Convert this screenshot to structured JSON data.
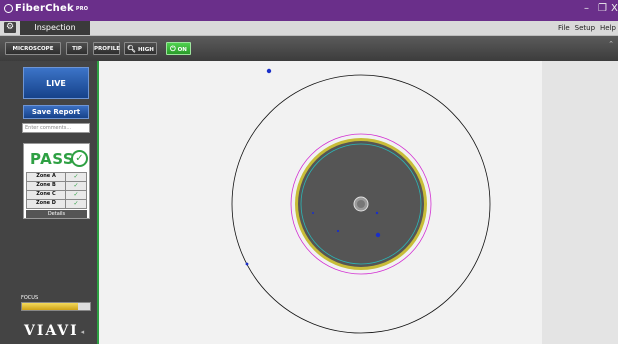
{
  "titlebar": {
    "app_name": "FiberChek",
    "app_suffix": "PRO",
    "minimize": "–",
    "restore": "❐",
    "close": "X"
  },
  "tabs": {
    "gear": "⚙",
    "active_tab": "Inspection",
    "menu_file": "File",
    "menu_setup": "Setup",
    "menu_help": "Help"
  },
  "toolbar": {
    "microscope": "MICROSCOPE",
    "tip": "TIP",
    "profile": "PROFILE",
    "high": "HIGH",
    "on": "ON"
  },
  "sidebar": {
    "live": "LIVE",
    "save_report": "Save Report",
    "comments_placeholder": "Enter comments...",
    "result": "PASS",
    "zones": [
      {
        "name": "Zone A",
        "status": "✓"
      },
      {
        "name": "Zone B",
        "status": "✓"
      },
      {
        "name": "Zone C",
        "status": "✓"
      },
      {
        "name": "Zone D",
        "status": "✓"
      }
    ],
    "details": "Details",
    "focus_label": "FOCUS",
    "focus_level": 0.82,
    "brand": "VIAVI"
  },
  "colors": {
    "titlebar": "#6a2f8a",
    "pass_green": "#2ea043",
    "live_blue": "#1e5bb0",
    "defect_blue": "#1a2fc9",
    "zone_magenta": "#d22fd2",
    "zone_cyan": "#2bb6b6"
  },
  "icons": {
    "gear": "gear-icon",
    "search": "magnifier-icon",
    "power": "power-icon",
    "check": "check-circle-icon"
  }
}
